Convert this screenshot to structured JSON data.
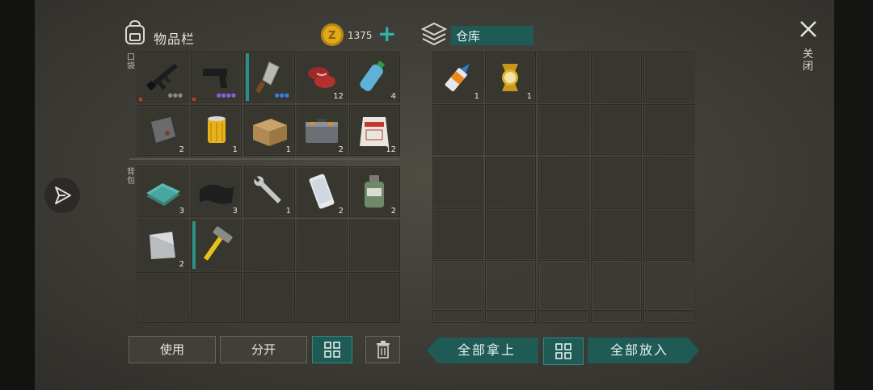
{
  "inventory": {
    "title": "物品栏",
    "currency": "1375",
    "add_symbol": "+",
    "pocket_label": "口袋",
    "backpack_label": "背包",
    "pocket_items": [
      {
        "name": "assault-rifle",
        "count": ""
      },
      {
        "name": "pistol",
        "count": ""
      },
      {
        "name": "cleaver",
        "count": ""
      },
      {
        "name": "raw-meat",
        "count": "12"
      },
      {
        "name": "water-bottle",
        "count": "4"
      },
      {
        "name": "metal-sheet",
        "count": "2"
      },
      {
        "name": "air-filter",
        "count": "1"
      },
      {
        "name": "wooden-crate",
        "count": "1"
      },
      {
        "name": "toolbox",
        "count": "2"
      },
      {
        "name": "fertilizer-bag",
        "count": "12"
      }
    ],
    "backpack_items": [
      {
        "name": "glass-pane",
        "count": "3"
      },
      {
        "name": "black-cloth",
        "count": "3"
      },
      {
        "name": "wrench",
        "count": "1"
      },
      {
        "name": "smartphone",
        "count": "2"
      },
      {
        "name": "chemical-jar",
        "count": "2"
      },
      {
        "name": "steel-plate",
        "count": "2"
      },
      {
        "name": "hammer",
        "count": ""
      }
    ],
    "buttons": {
      "use": "使用",
      "split": "分开"
    }
  },
  "storage": {
    "title": "仓库",
    "items": [
      {
        "name": "glue-tube",
        "count": "1"
      },
      {
        "name": "gold-watch",
        "count": "1"
      }
    ],
    "buttons": {
      "take_all": "全部拿上",
      "put_all": "全部放入"
    }
  },
  "close_label": "关闭",
  "colors": {
    "accent": "#1f5a55",
    "accent_border": "#2f8a82",
    "coin": "#e0a91a"
  }
}
